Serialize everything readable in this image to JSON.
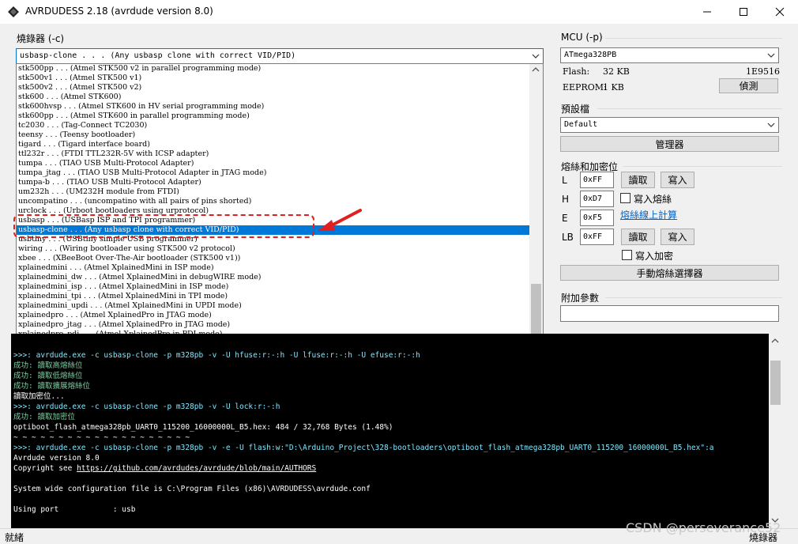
{
  "window": {
    "title": "AVRDUDESS 2.18 (avrdude version 8.0)"
  },
  "programmer": {
    "label": "燒錄器 (-c)",
    "selected": "usbasp-clone . . . (Any usbasp clone with correct VID/PID)",
    "items": [
      "stk500pp . . . (Atmel STK500 v2 in parallel programming mode)",
      "stk500v1 . . . (Atmel STK500 v1)",
      "stk500v2 . . . (Atmel STK500 v2)",
      "stk600 . . . (Atmel STK600)",
      "stk600hvsp . . . (Atmel STK600 in HV serial programming mode)",
      "stk600pp . . . (Atmel STK600 in parallel programming mode)",
      "tc2030 . . . (Tag-Connect TC2030)",
      "teensy . . . (Teensy bootloader)",
      "tigard . . . (Tigard interface board)",
      "ttl232r . . . (FTDI TTL232R-5V with ICSP adapter)",
      "tumpa . . . (TIAO USB Multi-Protocol Adapter)",
      "tumpa_jtag . . . (TIAO USB Multi-Protocol Adapter in JTAG mode)",
      "tumpa-b . . . (TIAO USB Multi-Protocol Adapter)",
      "um232h . . . (UM232H module from FTDI)",
      "uncompatino . . . (uncompatino with all pairs of pins shorted)",
      "urclock . . . (Urboot bootloaders using urprotocol)",
      "usbasp . . . (USBasp ISP and TPI programmer)",
      "usbasp-clone . . . (Any usbasp clone with correct VID/PID)",
      "usbtiny . . . (USBtiny simple USB programmer)",
      "wiring . . . (Wiring bootloader using STK500 v2 protocol)",
      "xbee . . . (XBeeBoot Over-The-Air bootloader (STK500 v1))",
      "xplainedmini . . . (Atmel XplainedMini in ISP mode)",
      "xplainedmini_dw . . . (Atmel XplainedMini in debugWIRE mode)",
      "xplainedmini_isp . . . (Atmel XplainedMini in ISP mode)",
      "xplainedmini_tpi . . . (Atmel XplainedMini in TPI mode)",
      "xplainedmini_updi . . . (Atmel XplainedMini in UPDI mode)",
      "xplainedpro . . . (Atmel XplainedPro in JTAG mode)",
      "xplainedpro_jtag . . . (Atmel XplainedPro in JTAG mode)",
      "xplainedpro_pdi . . . (Atmel XplainedPro in PDI mode)",
      "xplainedpro_updi . . . (Atmel XplainedPro in UPDI mode)"
    ],
    "selected_index": 17
  },
  "mcu": {
    "label": "MCU (-p)",
    "selected": "ATmega328PB",
    "flash_label": "Flash:",
    "flash_value": "32 KB",
    "signature": "1E9516",
    "eeprom_label": "EEPROM:",
    "eeprom_value": "1 KB",
    "detect_button": "偵測"
  },
  "presets": {
    "label": "預設檔",
    "selected": "Default",
    "manage_button": "管理器"
  },
  "fuses": {
    "label": "熔絲和加密位",
    "l_label": "L",
    "l_value": "0xFF",
    "h_label": "H",
    "h_value": "0xD7",
    "e_label": "E",
    "e_value": "0xF5",
    "lb_label": "LB",
    "lb_value": "0xFF",
    "read_button": "讀取",
    "write_button": "寫入",
    "write_fuses_label": "寫入熔絲",
    "write_fuses_checked": false,
    "calc_link": "熔絲線上計算",
    "write_lock_label": "寫入加密",
    "write_lock_checked": false,
    "selector_button": "手動熔絲選擇器"
  },
  "extra_args": {
    "label": "附加參數",
    "value": ""
  },
  "console": {
    "lines": [
      {
        "kind": "cmd",
        "text": ">>>: avrdude.exe -c usbasp-clone -p m328pb -v -U hfuse:r:-:h -U lfuse:r:-:h -U efuse:r:-:h"
      },
      {
        "kind": "ok",
        "text": "成功: 讀取高熔絲位"
      },
      {
        "kind": "ok",
        "text": "成功: 讀取低熔絲位"
      },
      {
        "kind": "ok",
        "text": "成功: 讀取擴展熔絲位"
      },
      {
        "kind": "txt",
        "text": "讀取加密位..."
      },
      {
        "kind": "cmd",
        "text": ">>>: avrdude.exe -c usbasp-clone -p m328pb -v -U lock:r:-:h"
      },
      {
        "kind": "ok",
        "text": "成功: 讀取加密位"
      },
      {
        "kind": "txt",
        "text": "optiboot_flash_atmega328pb_UART0_115200_16000000L_B5.hex: 484 / 32,768 Bytes (1.48%)"
      },
      {
        "kind": "txt",
        "text": "~ ~ ~ ~ ~ ~ ~ ~ ~ ~ ~ ~ ~ ~ ~ ~ ~ ~ ~ ~"
      },
      {
        "kind": "cmd",
        "text": ">>>: avrdude.exe -c usbasp-clone -p m328pb -v -e -U flash:w:\"D:\\Arduino_Project\\328-bootloaders\\optiboot_flash_atmega328pb_UART0_115200_16000000L_B5.hex\":a"
      },
      {
        "kind": "txt",
        "text": "Avrdude version 8.0"
      },
      {
        "kind": "link",
        "prefix": "Copyright see ",
        "text": "https://github.com/avrdudes/avrdude/blob/main/AUTHORS"
      },
      {
        "kind": "txt",
        "text": ""
      },
      {
        "kind": "txt",
        "text": "System wide configuration file is C:\\Program Files (x86)\\AVRDUDESS\\avrdude.conf"
      },
      {
        "kind": "txt",
        "text": ""
      },
      {
        "kind": "txt",
        "text": "Using port            : usb"
      }
    ]
  },
  "status": {
    "left": "就緒",
    "right": "燒錄器"
  },
  "watermark": "CSDN @perseverance52",
  "colors": {
    "selection": "#0078d7",
    "annotation": "#e02020",
    "console_bg": "#000000",
    "console_cmd": "#7fe7ff",
    "console_ok": "#7ec8a0"
  }
}
